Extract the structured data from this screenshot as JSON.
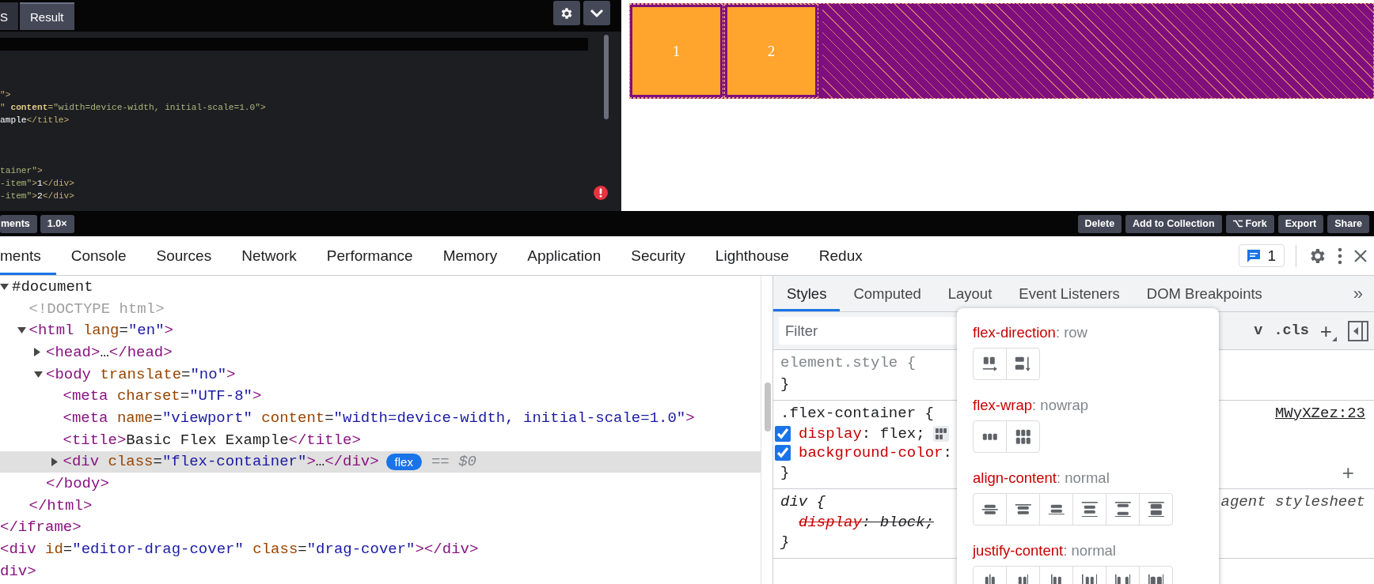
{
  "editor": {
    "tabs": [
      {
        "label": "S",
        "selected": false
      },
      {
        "label": "Result",
        "selected": true
      }
    ],
    "lines": [
      {
        "kind": "blank",
        "active": true
      },
      {
        "kind": "blank",
        "active": false
      },
      {
        "kind": "blank",
        "active": false
      },
      {
        "kind": "blank",
        "active": false
      },
      {
        "kind": "code",
        "active": false,
        "tokens": [
          {
            "kind": "punct",
            "text": "\">"
          }
        ]
      },
      {
        "kind": "code",
        "active": false,
        "tokens": [
          {
            "kind": "punct",
            "text": "\""
          },
          {
            "kind": "attr",
            "text": " content"
          },
          {
            "kind": "punct",
            "text": "="
          },
          {
            "kind": "string",
            "text": "\"width=device-width, initial-scale=1.0\""
          },
          {
            "kind": "punct",
            "text": ">"
          }
        ]
      },
      {
        "kind": "code",
        "active": false,
        "tokens": [
          {
            "kind": "text",
            "text": "ample"
          },
          {
            "kind": "punct",
            "text": "</title>"
          }
        ]
      },
      {
        "kind": "blank",
        "active": false
      },
      {
        "kind": "blank",
        "active": false
      },
      {
        "kind": "blank",
        "active": false
      },
      {
        "kind": "code",
        "active": false,
        "tokens": [
          {
            "kind": "string",
            "text": "tainer\""
          },
          {
            "kind": "punct",
            "text": ">"
          }
        ]
      },
      {
        "kind": "code",
        "active": false,
        "tokens": [
          {
            "kind": "string",
            "text": "-item\""
          },
          {
            "kind": "punct",
            "text": ">"
          },
          {
            "kind": "text",
            "text": "1"
          },
          {
            "kind": "punct",
            "text": "</div>"
          }
        ]
      },
      {
        "kind": "code",
        "active": false,
        "tokens": [
          {
            "kind": "string",
            "text": "-item\""
          },
          {
            "kind": "punct",
            "text": ">"
          },
          {
            "kind": "text",
            "text": "2"
          },
          {
            "kind": "punct",
            "text": "</div>"
          }
        ]
      }
    ],
    "has_error": true
  },
  "result": {
    "items": [
      {
        "label": "1"
      },
      {
        "label": "2"
      }
    ]
  },
  "bottom_bar": {
    "left_buttons": [
      {
        "label": "ments"
      },
      {
        "label": "1.0×"
      }
    ],
    "right_buttons": [
      {
        "label": "Delete",
        "has_icon": false
      },
      {
        "label": "Add to Collection",
        "has_icon": false
      },
      {
        "label": "Fork",
        "has_icon": true
      },
      {
        "label": "Export",
        "has_icon": false
      },
      {
        "label": "Share",
        "has_icon": false
      }
    ]
  },
  "devtools": {
    "tabs": [
      {
        "label": "ments",
        "selected": true
      },
      {
        "label": "Console",
        "selected": false
      },
      {
        "label": "Sources",
        "selected": false
      },
      {
        "label": "Network",
        "selected": false
      },
      {
        "label": "Performance",
        "selected": false
      },
      {
        "label": "Memory",
        "selected": false
      },
      {
        "label": "Application",
        "selected": false
      },
      {
        "label": "Security",
        "selected": false
      },
      {
        "label": "Lighthouse",
        "selected": false
      },
      {
        "label": "Redux",
        "selected": false
      }
    ],
    "issues_count": "1"
  },
  "dom_tree": [
    {
      "selected": false,
      "expanded": true,
      "tokens": [
        {
          "kind": "text",
          "text": "#document"
        }
      ],
      "children": [
        {
          "selected": false,
          "tokens": [
            {
              "kind": "doctype",
              "text": "<!DOCTYPE html>"
            }
          ]
        },
        {
          "selected": false,
          "expanded": true,
          "tokens": [
            {
              "kind": "tag",
              "text": "<html"
            },
            {
              "kind": "attr",
              "text": " lang"
            },
            {
              "kind": "text",
              "text": "="
            },
            {
              "kind": "value",
              "text": "\"en\""
            },
            {
              "kind": "tag",
              "text": ">"
            }
          ],
          "children": [
            {
              "selected": false,
              "expanded": false,
              "tokens": [
                {
                  "kind": "tag",
                  "text": "<head>"
                },
                {
                  "kind": "text",
                  "text": "…"
                },
                {
                  "kind": "tag",
                  "text": "</head>"
                }
              ]
            },
            {
              "selected": false,
              "expanded": true,
              "tokens": [
                {
                  "kind": "tag",
                  "text": "<body"
                },
                {
                  "kind": "attr",
                  "text": " translate"
                },
                {
                  "kind": "text",
                  "text": "="
                },
                {
                  "kind": "value",
                  "text": "\"no\""
                },
                {
                  "kind": "tag",
                  "text": ">"
                }
              ],
              "children": [
                {
                  "selected": false,
                  "tokens": [
                    {
                      "kind": "tag",
                      "text": "<meta"
                    },
                    {
                      "kind": "attr",
                      "text": " charset"
                    },
                    {
                      "kind": "text",
                      "text": "="
                    },
                    {
                      "kind": "value",
                      "text": "\"UTF-8\""
                    },
                    {
                      "kind": "tag",
                      "text": ">"
                    }
                  ]
                },
                {
                  "selected": false,
                  "tokens": [
                    {
                      "kind": "tag",
                      "text": "<meta"
                    },
                    {
                      "kind": "attr",
                      "text": " name"
                    },
                    {
                      "kind": "text",
                      "text": "="
                    },
                    {
                      "kind": "value",
                      "text": "\"viewport\""
                    },
                    {
                      "kind": "attr",
                      "text": " content"
                    },
                    {
                      "kind": "text",
                      "text": "="
                    },
                    {
                      "kind": "value",
                      "text": "\"width=device-width, initial-scale=1.0\""
                    },
                    {
                      "kind": "tag",
                      "text": ">"
                    }
                  ]
                },
                {
                  "selected": false,
                  "tokens": [
                    {
                      "kind": "tag",
                      "text": "<title>"
                    },
                    {
                      "kind": "text",
                      "text": "Basic Flex Example"
                    },
                    {
                      "kind": "tag",
                      "text": "</title>"
                    }
                  ]
                },
                {
                  "selected": true,
                  "expanded": false,
                  "tokens": [
                    {
                      "kind": "tag",
                      "text": "<div"
                    },
                    {
                      "kind": "attr",
                      "text": " class"
                    },
                    {
                      "kind": "text",
                      "text": "="
                    },
                    {
                      "kind": "value",
                      "text": "\"flex-container\""
                    },
                    {
                      "kind": "tag",
                      "text": ">"
                    },
                    {
                      "kind": "text",
                      "text": "…"
                    },
                    {
                      "kind": "tag",
                      "text": "</div>"
                    }
                  ],
                  "badge": "flex",
                  "reference": "== *$0*"
                }
              ],
              "closing": {
                "selected": false,
                "tokens": [
                  {
                    "kind": "tag",
                    "text": "</body>"
                  }
                ]
              }
            }
          ],
          "closing": {
            "selected": false,
            "tokens": [
              {
                "kind": "tag",
                "text": "</html>"
              }
            ]
          }
        }
      ]
    },
    {
      "selected": false,
      "tokens": [
        {
          "kind": "tag",
          "text": "</iframe>"
        }
      ]
    },
    {
      "selected": false,
      "tokens": [
        {
          "kind": "tag",
          "text": "<div"
        },
        {
          "kind": "attr",
          "text": " id"
        },
        {
          "kind": "text",
          "text": "="
        },
        {
          "kind": "value",
          "text": "\"editor-drag-cover\""
        },
        {
          "kind": "attr",
          "text": " class"
        },
        {
          "kind": "text",
          "text": "="
        },
        {
          "kind": "value",
          "text": "\"drag-cover\""
        },
        {
          "kind": "tag",
          "text": "></div>"
        }
      ]
    },
    {
      "selected": false,
      "tokens": [
        {
          "kind": "tag",
          "text": "div>"
        }
      ]
    }
  ],
  "styles": {
    "tabs": [
      {
        "label": "Styles",
        "selected": true
      },
      {
        "label": "Computed",
        "selected": false
      },
      {
        "label": "Layout",
        "selected": false
      },
      {
        "label": "Event Listeners",
        "selected": false
      },
      {
        "label": "DOM Breakpoints",
        "selected": false
      }
    ],
    "more": "»",
    "filter": {
      "placeholder": "Filter"
    },
    "state_toggle": "v",
    "class_toggle": ".cls",
    "new_rule": "+",
    "rules": [
      {
        "kind": "inline",
        "selector": "element.style {",
        "close": "}"
      },
      {
        "kind": "author",
        "selector": ".flex-container {",
        "source": "MWyXZez:23",
        "declarations": [
          {
            "name": "display",
            "value": ": flex;",
            "checked": true,
            "overridden": false,
            "editor_icon": true
          },
          {
            "name": "background-color",
            "value": ":",
            "checked": true,
            "overridden": false,
            "editor_icon": false
          }
        ],
        "close": "}",
        "add": "+"
      },
      {
        "kind": "agent",
        "selector": "div {",
        "source": "agent stylesheet",
        "declarations": [
          {
            "name": "display",
            "value": ": block;",
            "overridden": true
          }
        ],
        "close": "}"
      }
    ]
  },
  "flexbox_editor": {
    "sections": [
      {
        "kind": "direction",
        "property": "flex-direction",
        "value": ": row",
        "options": [
          {
            "selected": false
          },
          {
            "selected": false
          }
        ]
      },
      {
        "kind": "wrap",
        "property": "flex-wrap",
        "value": ": nowrap",
        "options": [
          {
            "selected": false
          },
          {
            "selected": false
          }
        ]
      },
      {
        "kind": "align",
        "property": "align-content",
        "value": ": normal",
        "options": [
          {
            "selected": false
          },
          {
            "selected": false
          },
          {
            "selected": false
          },
          {
            "selected": false
          },
          {
            "selected": false
          },
          {
            "selected": false
          }
        ]
      },
      {
        "kind": "justify",
        "property": "justify-content",
        "value": ": normal",
        "options": [
          {
            "selected": false
          },
          {
            "selected": false
          },
          {
            "selected": false
          },
          {
            "selected": false
          },
          {
            "selected": false
          },
          {
            "selected": false
          }
        ]
      }
    ]
  }
}
